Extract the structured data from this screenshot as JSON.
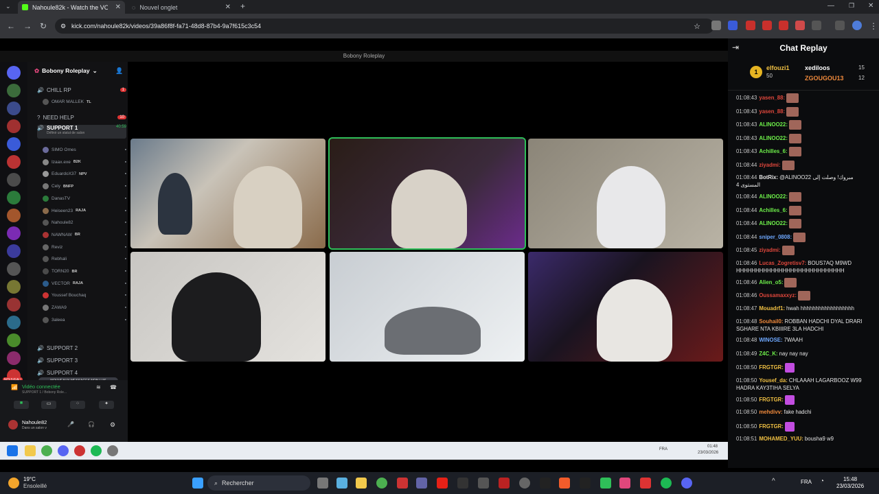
{
  "browser": {
    "tabs": [
      {
        "title": "Nahoule82k - Watch the VO"
      },
      {
        "title": "Nouvel onglet"
      }
    ],
    "url": "kick.com/nahoule82k/videos/39a86f8f-fa71-48d8-87b4-9a7f615c3c54"
  },
  "discord": {
    "window_title": "Bobony Roleplay",
    "server_name": "Bobony Roleplay",
    "guild_badges": [
      "909",
      "183",
      "121",
      "6",
      "54",
      "3"
    ],
    "channels": [
      {
        "name": "CHILL RP",
        "badge": "1"
      },
      {
        "name": "OMAR MALLEK",
        "tag": "TL"
      },
      {
        "name": "NEED HELP",
        "badge": "10"
      },
      {
        "name": "SUPPORT 1",
        "time": "40:59",
        "status": "Définir un statut de salon"
      }
    ],
    "users": [
      {
        "name": "SIMO Omes",
        "tag": ""
      },
      {
        "name": "Izaax.exe",
        "tag": "B2K"
      },
      {
        "name": "EduardoX37",
        "tag": "NPV"
      },
      {
        "name": "Cely",
        "tag": "BNFP"
      },
      {
        "name": "DanasTV",
        "tag": ""
      },
      {
        "name": "Heiseen23",
        "tag": "RAJA"
      },
      {
        "name": "Nahoule82",
        "tag": ""
      },
      {
        "name": "NAWNAW",
        "tag": "BR"
      },
      {
        "name": "Reviz",
        "tag": ""
      },
      {
        "name": "Rebhali",
        "tag": ""
      },
      {
        "name": "TORN20",
        "tag": "BR"
      },
      {
        "name": "VECTOR",
        "tag": "RAJA"
      },
      {
        "name": "Youssef Bouchaq",
        "tag": ""
      },
      {
        "name": "ZAWA9",
        "tag": ""
      },
      {
        "name": "3aleea",
        "tag": ""
      }
    ],
    "support_channels": [
      "SUPPORT 2",
      "SUPPORT 3",
      "SUPPORT 4"
    ],
    "new_messages": "NOUVEAUX MESSAGES NON LUS",
    "new_badge": "NOUVEAU",
    "voice_status": "Vidéo connectée",
    "voice_channel": "SUPPORT 1 / Bobony Role...",
    "self_name": "Nahoule82",
    "self_status": "Dans un salon v"
  },
  "inner_taskbar": {
    "lang": "FRA",
    "time": "01:48",
    "date": "23/03/2026"
  },
  "chat": {
    "title": "Chat Replay",
    "leaders": [
      {
        "name": "elfouzi1",
        "score": "50"
      },
      {
        "name": "xediloos",
        "score": "15"
      },
      {
        "name": "ZGOUGOU13",
        "score": "12"
      }
    ],
    "messages": [
      {
        "time": "01:08:43",
        "user": "yasen_88:",
        "color": "#e0473c",
        "text": "",
        "emote": true
      },
      {
        "time": "01:08:43",
        "user": "yasen_88:",
        "color": "#e0473c",
        "text": "",
        "emote": true
      },
      {
        "time": "01:08:43",
        "user": "ALINOO22:",
        "color": "#6ef04a",
        "text": "",
        "emote": true
      },
      {
        "time": "01:08:43",
        "user": "ALINOO22:",
        "color": "#6ef04a",
        "text": "",
        "emote": true
      },
      {
        "time": "01:08:43",
        "user": "Achilles_6:",
        "color": "#6ef04a",
        "text": "",
        "emote": true
      },
      {
        "time": "01:08:44",
        "user": "ziyadmi:",
        "color": "#e0473c",
        "text": "",
        "emote": true
      },
      {
        "time": "01:08:44",
        "user": "BotRix:",
        "color": "#e6e6e6",
        "text": "@ALINOO22 مبروك! وصلت إلى المستوى 4",
        "emote": false
      },
      {
        "time": "01:08:44",
        "user": "ALINOO22:",
        "color": "#6ef04a",
        "text": "",
        "emote": true
      },
      {
        "time": "01:08:44",
        "user": "Achilles_6:",
        "color": "#6ef04a",
        "text": "",
        "emote": true
      },
      {
        "time": "01:08:44",
        "user": "ALINOO22:",
        "color": "#6ef04a",
        "text": "",
        "emote": true
      },
      {
        "time": "01:08:44",
        "user": "sniper_0808:",
        "color": "#6ea8ff",
        "text": "",
        "emote": true
      },
      {
        "time": "01:08:45",
        "user": "ziyadmi:",
        "color": "#e0473c",
        "text": "",
        "emote": true
      },
      {
        "time": "01:08:46",
        "user": "Lucas_Zogretisv7:",
        "color": "#e0473c",
        "text": "BOUS7AQ M9WD HHHHHHHHHHHHHHHHHHHHHHHHHHHH",
        "emote": false
      },
      {
        "time": "01:08:46",
        "user": "Alien_o5:",
        "color": "#6ef04a",
        "text": "",
        "emote": true
      },
      {
        "time": "01:08:46",
        "user": "Oussamaxxyz:",
        "color": "#e0473c",
        "text": "",
        "emote": true
      },
      {
        "time": "01:08:47",
        "user": "Mouadrf1:",
        "color": "#f0c043",
        "text": "hwah hhhhhhhhhhhhhhhhhh",
        "emote": false
      },
      {
        "time": "01:08:48",
        "user": "Souhail0:",
        "color": "#f08a3c",
        "text": "ROBBAN HADCHI DYAL DRARI SGHARE NTA KBIIIRE 3LA HADCHI",
        "emote": false
      },
      {
        "time": "01:08:48",
        "user": "WINOSE:",
        "color": "#6ea8ff",
        "text": "7WAAH",
        "emote": false
      },
      {
        "time": "01:08:49",
        "user": "Z4C_K:",
        "color": "#6ef04a",
        "text": "nay nay nay",
        "emote": false
      },
      {
        "time": "01:08:50",
        "user": "FRGTGR:",
        "color": "#f0c043",
        "text": "",
        "emote": true
      },
      {
        "time": "01:08:50",
        "user": "Yousef_da:",
        "color": "#f0c043",
        "text": "CHLAAAH LAGARBOOZ W99 HADRA KAY3TIHA SELYA",
        "emote": false
      },
      {
        "time": "01:08:50",
        "user": "FRGTGR:",
        "color": "#f0c043",
        "text": "",
        "emote": true
      },
      {
        "time": "01:08:50",
        "user": "mehdivv:",
        "color": "#f08a3c",
        "text": "fake hadchi",
        "emote": false
      },
      {
        "time": "01:08:50",
        "user": "FRGTGR:",
        "color": "#f0c043",
        "text": "",
        "emote": true
      },
      {
        "time": "01:08:51",
        "user": "MOHAMED_YUU:",
        "color": "#f0c043",
        "text": "bousha9 w9",
        "emote": false
      }
    ]
  },
  "taskbar": {
    "weather_temp": "19°C",
    "weather_desc": "Ensoleillé",
    "search_placeholder": "Rechercher",
    "lang": "FRA",
    "time": "15:48",
    "date": "23/03/2026"
  }
}
